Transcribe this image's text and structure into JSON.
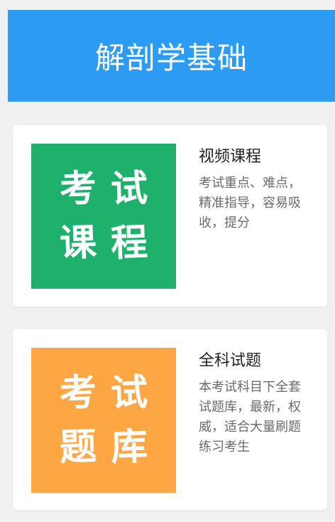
{
  "header": {
    "title": "解剖学基础",
    "color": "#2b9bf4"
  },
  "cards": [
    {
      "tile_chars": [
        "考",
        "试",
        "课",
        "程"
      ],
      "tile_color": "#1eb16c",
      "title": "视频课程",
      "description": "考试重点、难点，精准指导，容易吸收，提分"
    },
    {
      "tile_chars": [
        "考",
        "试",
        "题",
        "库"
      ],
      "tile_color": "#fda744",
      "title": "全科试题",
      "description": "本考试科目下全套试题库，最新，权威，适合大量刷题练习考生"
    }
  ]
}
